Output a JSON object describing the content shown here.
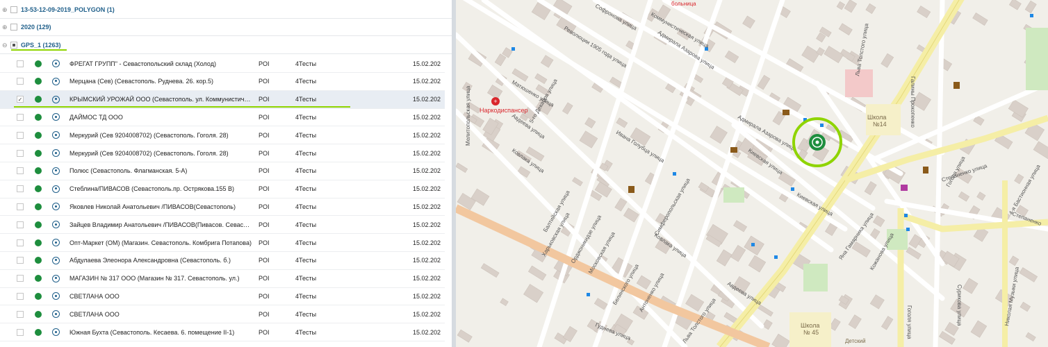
{
  "groups": [
    {
      "label": "13-53-12-09-2019_POLYGON (1)",
      "expander": "⊕"
    },
    {
      "label": "2020 (129)",
      "expander": "⊕"
    },
    {
      "label": "GPS_1 (1263)",
      "expander": "⊖"
    }
  ],
  "rows": [
    {
      "name": "ФРЕГАТ ГРУПП\" - Севастопольский склад (Холод)",
      "type": "POI",
      "category": "4Тесты",
      "date": "15.02.202",
      "checked": false
    },
    {
      "name": "Мерцана (Сев) (Севастополь. Руднева. 26. кор.5)",
      "type": "POI",
      "category": "4Тесты",
      "date": "15.02.202",
      "checked": false
    },
    {
      "name": "КРЫМСКИЙ УРОЖАЙ ООО (Севастополь. ул. Коммунистическая)",
      "type": "POI",
      "category": "4Тесты",
      "date": "15.02.202",
      "checked": true
    },
    {
      "name": "ДАЙМОС ТД ООО",
      "type": "POI",
      "category": "4Тесты",
      "date": "15.02.202",
      "checked": false
    },
    {
      "name": "Меркурий (Сев 9204008702) (Севастополь. Гоголя. 28)",
      "type": "POI",
      "category": "4Тесты",
      "date": "15.02.202",
      "checked": false
    },
    {
      "name": "Меркурий (Сев 9204008702) (Севастополь. Гоголя. 28)",
      "type": "POI",
      "category": "4Тесты",
      "date": "15.02.202",
      "checked": false
    },
    {
      "name": "Полюс (Севастополь. Флагманская. 5-А)",
      "type": "POI",
      "category": "4Тесты",
      "date": "15.02.202",
      "checked": false
    },
    {
      "name": "Стеблина/ПИВАСОВ (Севастополь.пр. Острякова.155 В)",
      "type": "POI",
      "category": "4Тесты",
      "date": "15.02.202",
      "checked": false
    },
    {
      "name": "Яковлев Николай Анатольевич /ПИВАСОВ(Севастополь)",
      "type": "POI",
      "category": "4Тесты",
      "date": "15.02.202",
      "checked": false
    },
    {
      "name": "Зайцев Владимир Анатольевич /ПИВАСОВ(Пивасов. Севастополь)",
      "type": "POI",
      "category": "4Тесты",
      "date": "15.02.202",
      "checked": false
    },
    {
      "name": "Опт-Маркет (ОМ) (Магазин. Севастополь. Комбрига Потапова)",
      "type": "POI",
      "category": "4Тесты",
      "date": "15.02.202",
      "checked": false
    },
    {
      "name": "Абдулаева Элеонора Александровна (Севастополь. б.)",
      "type": "POI",
      "category": "4Тесты",
      "date": "15.02.202",
      "checked": false
    },
    {
      "name": "МАГАЗИН № 317 ООО (Магазин № 317. Севастополь. ул.)",
      "type": "POI",
      "category": "4Тесты",
      "date": "15.02.202",
      "checked": false
    },
    {
      "name": "СВЕТЛАНА ООО",
      "type": "POI",
      "category": "4Тесты",
      "date": "15.02.202",
      "checked": false
    },
    {
      "name": "СВЕТЛАНА ООО",
      "type": "POI",
      "category": "4Тесты",
      "date": "15.02.202",
      "checked": false
    },
    {
      "name": "Южная Бухта (Севастополь. Кесаева. 6. помещение II-1)",
      "type": "POI",
      "category": "4Тесты",
      "date": "15.02.202",
      "checked": false
    }
  ],
  "map": {
    "labels": {
      "narco": "Наркодиспансер",
      "school14": "Школа",
      "school14n": "№14",
      "school45": "Школа",
      "school45n": "№ 45",
      "detsky": "Детский",
      "ivanaGolubtsa": "Ивана Голубца улица",
      "kievskaya": "Киевская улица",
      "kievskaya2": "Киевская улица",
      "admiralaAzarova": "Адмирала Азарова улица",
      "admiralaAzarova2": "Адмирала Азарова улица",
      "revolyutsii": "Революции 1905 года улица",
      "matyushenko": "Матюшенко улица",
      "dekabrya": "5-го Декабря улица",
      "avdeeva": "Авдеева улица",
      "avdeeva2": "Авдеева улица",
      "kovlaka": "Ковлака улица",
      "kovlaka2": "Ковлака улица",
      "simferopolskaya": "Симферопольская улица",
      "baltiyskaya": "Балтийская улица",
      "kharkovskaya": "Харьковская улица",
      "ordzhonikidze": "Орджоникидзе улица",
      "moskovskaya": "Московская улица",
      "belinskogo": "Белинского улица",
      "antonenko": "Антоненко улица",
      "gudneva": "Гуднева улица",
      "lvaTolstogo": "Льва Толстого улица",
      "lvaTolstogo2": "Льва Толстого улица",
      "gogolya": "Гоголя улица",
      "gogolya2": "Гоголя улица",
      "stepanenko": "Степаненко улица",
      "bastionnaya": "4-я Бастионная улица",
      "kozhanova": "Кожанова улица",
      "surikova": "Сурикова улица",
      "gagarina": "Яна Гамарника улица",
      "sofronova": "Софронова улица",
      "kommunisticheskaya": "Коммунистическая улица",
      "melitopolskaya": "Мелитопольская улица",
      "galiny": "Галины Прокопенко",
      "nikolaya": "Николая Музыки улица",
      "bolnitsa": "больница",
      "stepanenko2": "Степаненко"
    }
  },
  "colors": {
    "accent": "#8fd400",
    "markerGreen": "#1e8e3e",
    "link": "#1f5f8a"
  }
}
